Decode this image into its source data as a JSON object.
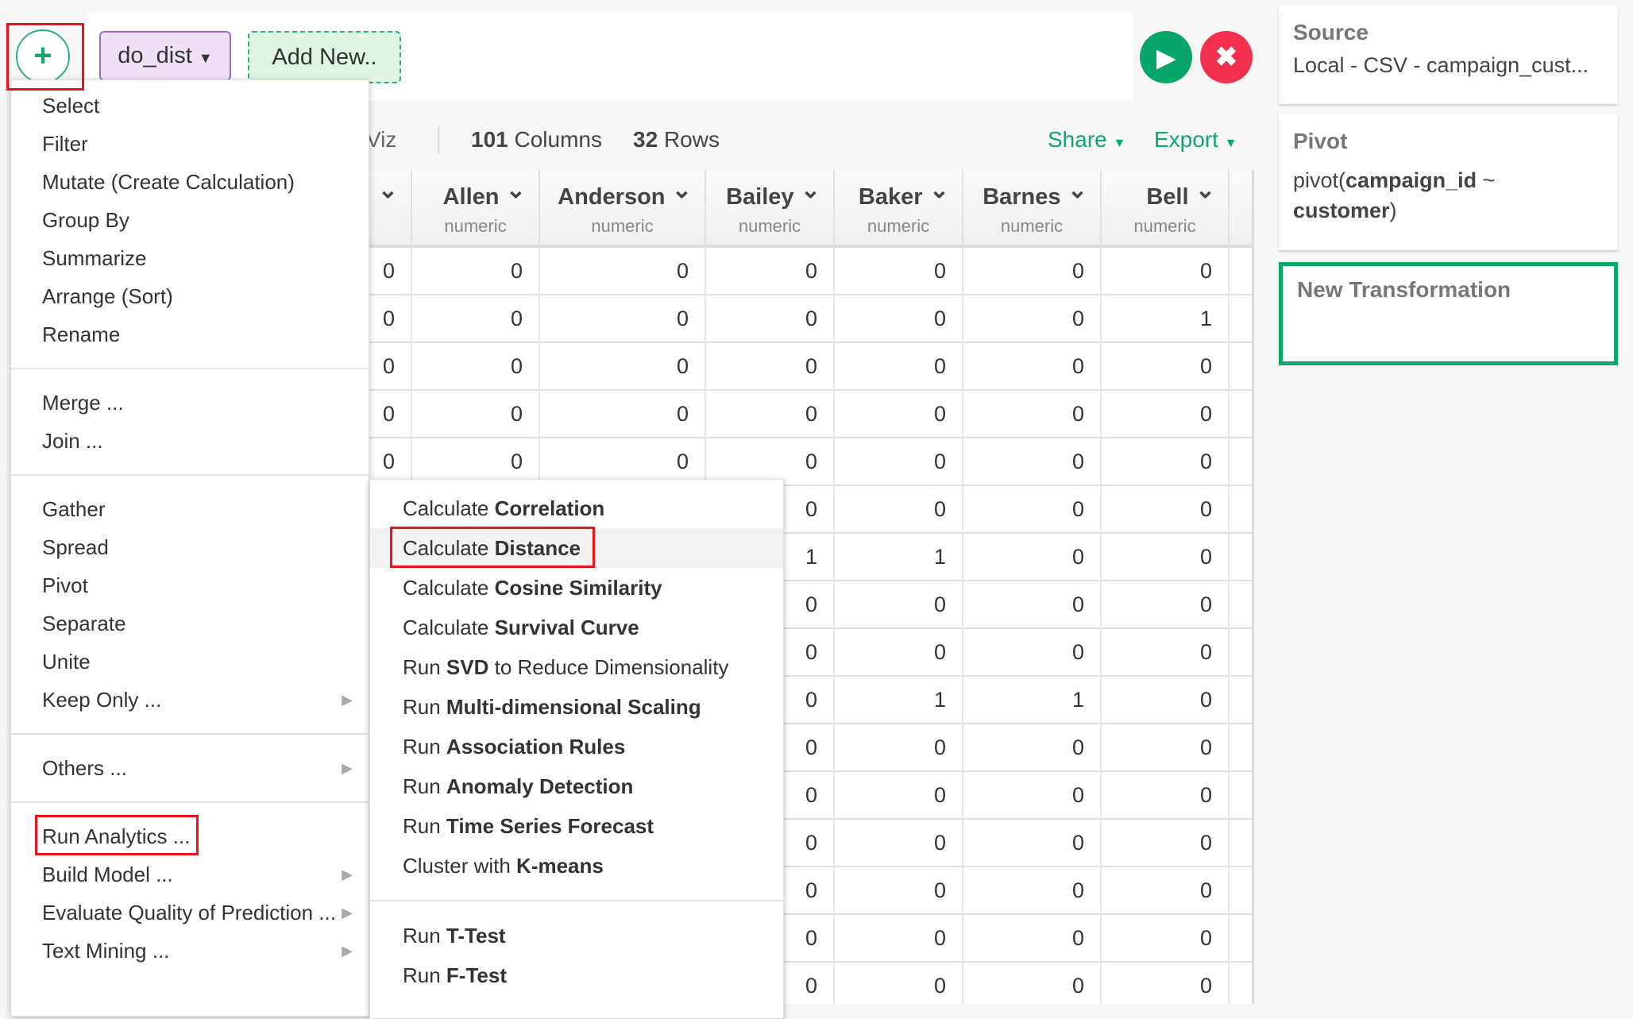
{
  "header": {
    "add_icon": "plus-icon",
    "step_label": "do_dist",
    "add_new_label": "Add New..",
    "run_icon": "play-icon",
    "cancel_icon": "close-icon"
  },
  "toolbar": {
    "viz_tab_partial": "Viz",
    "columns_count": "101",
    "columns_label": "Columns",
    "rows_count": "32",
    "rows_label": "Rows",
    "share_label": "Share",
    "export_label": "Export"
  },
  "steps": {
    "source": {
      "title": "Source",
      "body": "Local - CSV - campaign_cust..."
    },
    "pivot": {
      "title": "Pivot",
      "body_parts": [
        {
          "text": "pivot(",
          "bold": false
        },
        {
          "text": "campaign_id",
          "bold": true
        },
        {
          "text": " ~ ",
          "bold": false
        },
        {
          "text": "customer",
          "bold": true
        },
        {
          "text": ")",
          "bold": false
        }
      ]
    },
    "new": {
      "title": "New Transformation"
    }
  },
  "table": {
    "columns": [
      {
        "name": "",
        "type": ""
      },
      {
        "name": "Allen",
        "type": "numeric"
      },
      {
        "name": "Anderson",
        "type": "numeric"
      },
      {
        "name": "Bailey",
        "type": "numeric"
      },
      {
        "name": "Baker",
        "type": "numeric"
      },
      {
        "name": "Barnes",
        "type": "numeric"
      },
      {
        "name": "Bell",
        "type": "numeric"
      }
    ],
    "rows": [
      [
        "0",
        "0",
        "0",
        "0",
        "0",
        "0",
        "0"
      ],
      [
        "0",
        "0",
        "0",
        "0",
        "0",
        "0",
        "1"
      ],
      [
        "0",
        "0",
        "0",
        "0",
        "0",
        "0",
        "0"
      ],
      [
        "0",
        "0",
        "0",
        "0",
        "0",
        "0",
        "0"
      ],
      [
        "0",
        "0",
        "0",
        "0",
        "0",
        "0",
        "0"
      ],
      [
        null,
        null,
        null,
        "0",
        "0",
        "0",
        "0"
      ],
      [
        null,
        null,
        null,
        "1",
        "1",
        "0",
        "0"
      ],
      [
        null,
        null,
        null,
        "0",
        "0",
        "0",
        "0"
      ],
      [
        null,
        null,
        null,
        "0",
        "0",
        "0",
        "0"
      ],
      [
        null,
        null,
        null,
        "0",
        "1",
        "1",
        "0"
      ],
      [
        null,
        null,
        null,
        "0",
        "0",
        "0",
        "0"
      ],
      [
        null,
        null,
        null,
        "0",
        "0",
        "0",
        "0"
      ],
      [
        null,
        null,
        null,
        "0",
        "0",
        "0",
        "0"
      ],
      [
        null,
        null,
        null,
        "0",
        "0",
        "0",
        "0"
      ],
      [
        null,
        null,
        null,
        "0",
        "0",
        "0",
        "0"
      ],
      [
        null,
        null,
        null,
        "0",
        "0",
        "0",
        "0"
      ]
    ]
  },
  "main_menu": {
    "groups": [
      [
        {
          "label": "Select"
        },
        {
          "label": "Filter"
        },
        {
          "label": "Mutate (Create Calculation)"
        },
        {
          "label": "Group By"
        },
        {
          "label": "Summarize"
        },
        {
          "label": "Arrange (Sort)"
        },
        {
          "label": "Rename"
        }
      ],
      [
        {
          "label": "Merge ..."
        },
        {
          "label": "Join ..."
        }
      ],
      [
        {
          "label": "Gather"
        },
        {
          "label": "Spread"
        },
        {
          "label": "Pivot"
        },
        {
          "label": "Separate"
        },
        {
          "label": "Unite"
        },
        {
          "label": "Keep Only ...",
          "submenu": true
        }
      ],
      [
        {
          "label": "Others ...",
          "submenu": true
        }
      ],
      [
        {
          "label": "Run Analytics ...",
          "active": true
        },
        {
          "label": "Build Model ...",
          "submenu": true
        },
        {
          "label": "Evaluate Quality of Prediction ...",
          "submenu": true
        },
        {
          "label": "Text Mining ...",
          "submenu": true
        }
      ]
    ]
  },
  "analytics_menu": {
    "groups": [
      [
        {
          "pre": "Calculate ",
          "bold": "Correlation",
          "post": ""
        },
        {
          "pre": "Calculate ",
          "bold": "Distance",
          "post": "",
          "highlighted": true
        },
        {
          "pre": "Calculate ",
          "bold": "Cosine Similarity",
          "post": ""
        },
        {
          "pre": "Calculate ",
          "bold": "Survival Curve",
          "post": ""
        },
        {
          "pre": "Run ",
          "bold": "SVD",
          "post": " to Reduce Dimensionality"
        },
        {
          "pre": "Run ",
          "bold": "Multi-dimensional Scaling",
          "post": ""
        },
        {
          "pre": "Run ",
          "bold": "Association Rules",
          "post": ""
        },
        {
          "pre": "Run ",
          "bold": "Anomaly Detection",
          "post": ""
        },
        {
          "pre": "Run ",
          "bold": "Time Series Forecast",
          "post": ""
        },
        {
          "pre": "Cluster with ",
          "bold": "K-means",
          "post": ""
        }
      ],
      [
        {
          "pre": "Run ",
          "bold": "T-Test",
          "post": ""
        },
        {
          "pre": "Run ",
          "bold": "F-Test",
          "post": ""
        }
      ]
    ]
  },
  "colors": {
    "accent_green": "#0aa86a",
    "run": "#08a66b",
    "cancel": "#f4304f",
    "annotation_red": "#e8141b",
    "step_purple": "#efe0f5"
  }
}
